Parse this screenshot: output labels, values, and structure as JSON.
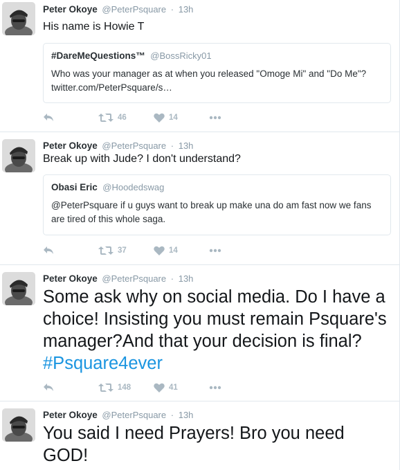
{
  "colors": {
    "hashtag": "#1b95e0",
    "muted": "#8899a6",
    "border": "#e1e8ed",
    "action_icon": "#aab8c2"
  },
  "tweets": [
    {
      "name": "Peter Okoye",
      "handle": "@PeterPsquare",
      "separator": "·",
      "time": "13h",
      "text": "His name is Howie T",
      "quote": {
        "name": "#DareMeQuestions™",
        "handle": "@BossRicky01",
        "text": "Who was your manager as at when you released \"Omoge Mi\" and \"Do Me\"? twitter.com/PeterPsquare/s…"
      },
      "retweets": "46",
      "likes": "14",
      "icons": [
        "reply-icon",
        "retweet-icon",
        "heart-icon",
        "more-icon"
      ]
    },
    {
      "name": "Peter Okoye",
      "handle": "@PeterPsquare",
      "separator": "·",
      "time": "13h",
      "text": "Break up with Jude? I don't understand?",
      "quote": {
        "name": "Obasi Eric",
        "handle": "@Hoodedswag",
        "text": "@PeterPsquare if u guys want to break up make una do am fast now we fans are tired of this whole saga."
      },
      "retweets": "37",
      "likes": "14",
      "icons": [
        "reply-icon",
        "retweet-icon",
        "heart-icon",
        "more-icon"
      ]
    },
    {
      "name": "Peter Okoye",
      "handle": "@PeterPsquare",
      "separator": "·",
      "time": "13h",
      "text_before_hashtag": "Some ask why on social media. Do I have a choice! Insisting you must remain Psquare's manager?And that your decision is final? ",
      "hashtag": "#Psquare4ever",
      "retweets": "148",
      "likes": "41",
      "icons": [
        "reply-icon",
        "retweet-icon",
        "heart-icon",
        "more-icon"
      ]
    },
    {
      "name": "Peter Okoye",
      "handle": "@PeterPsquare",
      "separator": "·",
      "time": "13h",
      "text": "You said I need Prayers! Bro you need GOD!"
    }
  ]
}
